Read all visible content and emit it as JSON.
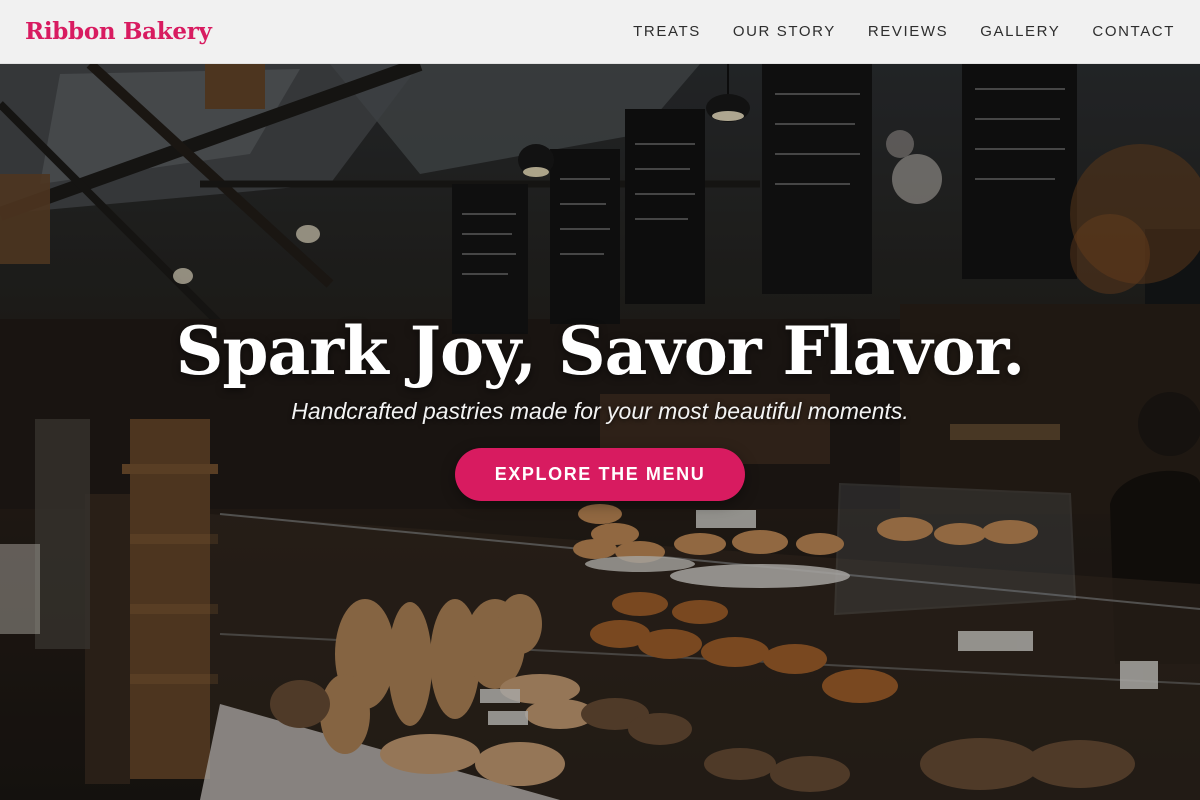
{
  "header": {
    "logo": "Ribbon Bakery",
    "nav": [
      {
        "label": "TREATS"
      },
      {
        "label": "OUR STORY"
      },
      {
        "label": "REVIEWS"
      },
      {
        "label": "GALLERY"
      },
      {
        "label": "CONTACT"
      }
    ]
  },
  "hero": {
    "title": "Spark Joy, Savor Flavor.",
    "subtitle": "Handcrafted pastries made for your most beautiful moments.",
    "cta_label": "EXPLORE THE MENU"
  },
  "colors": {
    "brand": "#d81b60",
    "nav_background": "#f1f1f1",
    "nav_text": "#2e2e2e",
    "hero_text": "#ffffff"
  }
}
